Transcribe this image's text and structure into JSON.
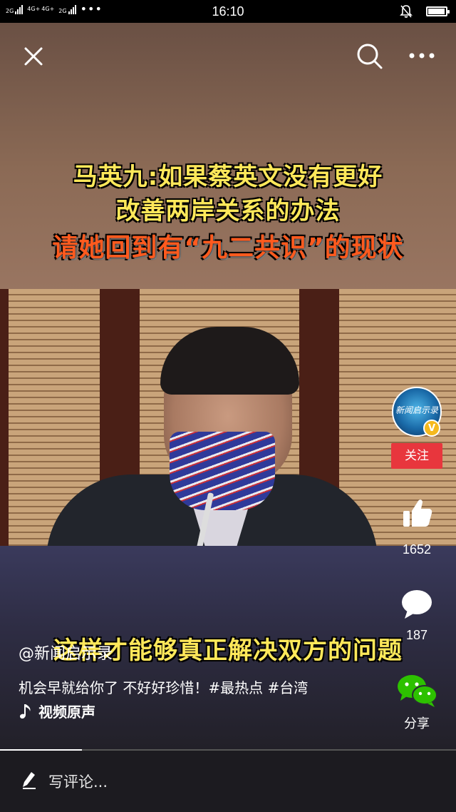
{
  "status_bar": {
    "network_1": "2G",
    "network_2a": "4G+",
    "network_2b": "4G+",
    "network_2c": "2G",
    "time": "16:10",
    "battery_level": 0.9
  },
  "video": {
    "caption_line1": "马英九:如果蔡英文没有更好",
    "caption_line2": "改善两岸关系的办法",
    "caption_line3": "请她回到有“九二共识”的现状",
    "subtitle": "这样才能够真正解决双方的问题",
    "progress": 0.18
  },
  "account": {
    "avatar_text": "新闻启示录",
    "verified_mark": "V",
    "follow_label": "关注"
  },
  "actions": {
    "like_count": "1652",
    "comment_count": "187",
    "share_label": "分享"
  },
  "post": {
    "author": "@新闻启示录",
    "description": "机会早就给你了 不好好珍惜！#最热点 #台湾",
    "music": "视频原声"
  },
  "comment_bar": {
    "placeholder": "写评论..."
  },
  "icons": {
    "close": "close-icon",
    "search": "search-icon",
    "more": "more-icon",
    "like": "thumbs-up-icon",
    "comment": "comment-bubble-icon",
    "share": "wechat-icon",
    "music": "music-note-icon",
    "pen": "pen-icon"
  }
}
